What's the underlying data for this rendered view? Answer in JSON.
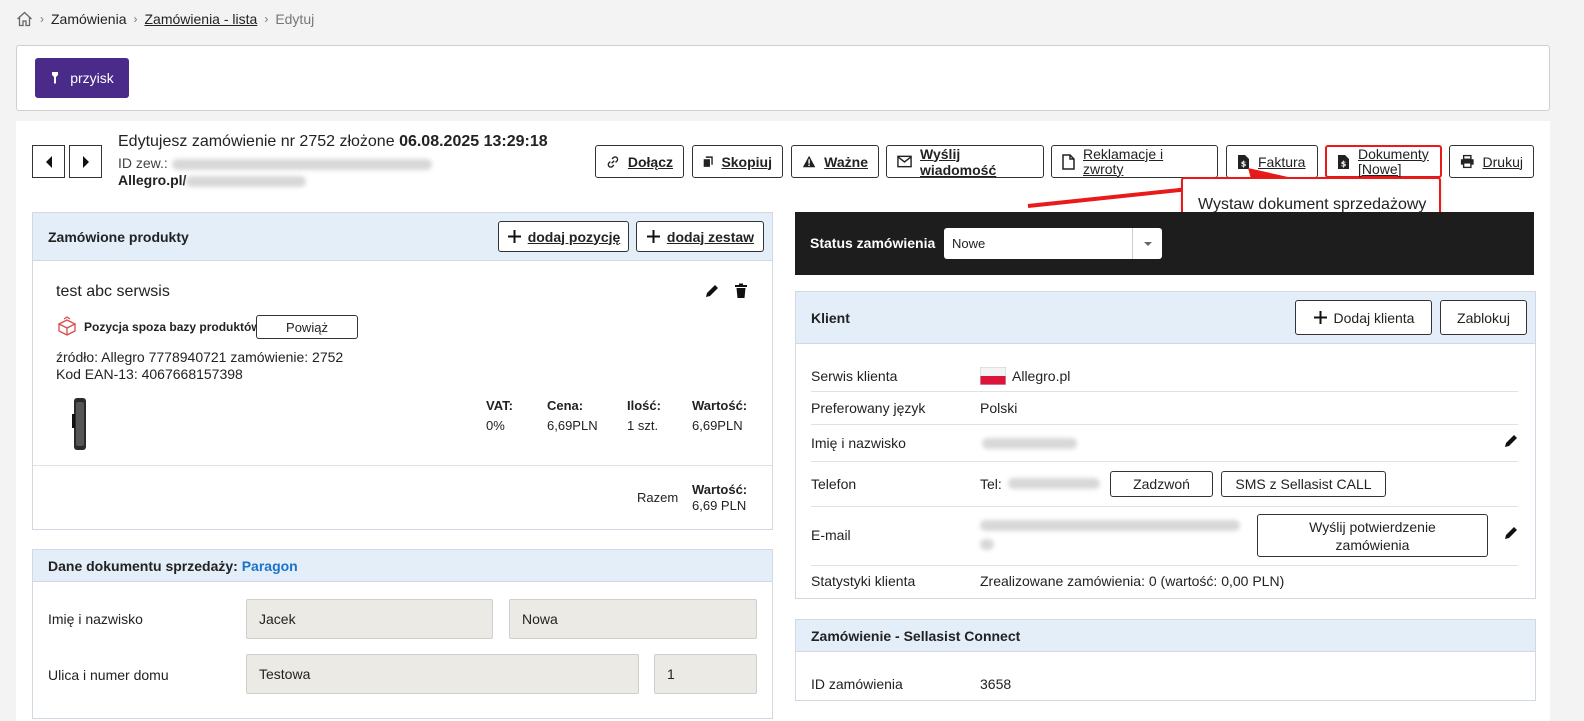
{
  "breadcrumb": {
    "items": [
      "Zamówienia",
      "Zamówienia - lista",
      "Edytuj"
    ]
  },
  "toolbar": {
    "plugin_button": "przyisk"
  },
  "order": {
    "title_prefix": "Edytujesz zamówienie nr 2752 złożone",
    "title_date": "06.08.2025 13:29:18",
    "ext_id_label": "ID zew.:",
    "source_prefix": "Allegro.pl/"
  },
  "actions": {
    "attach": "Dołącz",
    "copy": "Skopiuj",
    "important": "Ważne",
    "send_message": "Wyślij wiadomość",
    "complaints_l1": "Reklamacje i",
    "complaints_l2": "zwroty",
    "invoice": "Faktura",
    "documents_l1": "Dokumenty",
    "documents_l2": "[Nowe]",
    "print": "Drukuj"
  },
  "documents_dropdown": {
    "item": "Wystaw dokument sprzedażowy"
  },
  "products": {
    "header": "Zamówione produkty",
    "add_item": "dodaj pozycję",
    "add_set": "dodaj zestaw",
    "item_name": "test abc serwsis",
    "external_label": "Pozycja spoza bazy produktów",
    "link_button": "Powiąż",
    "source_line": "źródło: Allegro 7778940721 zamówienie: 2752",
    "ean_line": "Kod EAN-13: 4067668157398",
    "vat_label": "VAT:",
    "vat_value": "0%",
    "price_label": "Cena:",
    "price_value": "6,69PLN",
    "qty_label": "Ilość:",
    "qty_value": "1 szt.",
    "value_label": "Wartość:",
    "value_value": "6,69PLN",
    "total_label": "Razem",
    "total_value_label": "Wartość:",
    "total_value": "6,69 PLN"
  },
  "sales_doc": {
    "header_prefix": "Dane dokumentu sprzedaży:",
    "doc_type": "Paragon",
    "name_label": "Imię i nazwisko",
    "first_name": "Jacek",
    "last_name": "Nowa",
    "street_label": "Ulica i numer domu",
    "street": "Testowa",
    "house_no": "1"
  },
  "status": {
    "label": "Status zamówienia",
    "value": "Nowe"
  },
  "client": {
    "header": "Klient",
    "add_client": "Dodaj klienta",
    "block": "Zablokuj",
    "service_label": "Serwis klienta",
    "service_value": "Allegro.pl",
    "language_label": "Preferowany język",
    "language_value": "Polski",
    "name_label": "Imię i nazwisko",
    "phone_label": "Telefon",
    "phone_prefix": "Tel:",
    "call_button": "Zadzwoń",
    "sms_button": "SMS z Sellasist CALL",
    "email_label": "E-mail",
    "confirm_l1": "Wyślij potwierdzenie",
    "confirm_l2": "zamówienia",
    "stats_label": "Statystyki klienta",
    "stats_value": "Zrealizowane zamówienia: 0 (wartość: 0,00 PLN)"
  },
  "connect": {
    "header": "Zamówienie - Sellasist Connect",
    "order_id_label": "ID zamówienia",
    "order_id_value": "3658"
  },
  "colors": {
    "accent_purple": "#4b2b8a",
    "highlight_red": "#e81a1a",
    "link_blue": "#1a73c9",
    "status_bar": "#1d1d1d"
  }
}
